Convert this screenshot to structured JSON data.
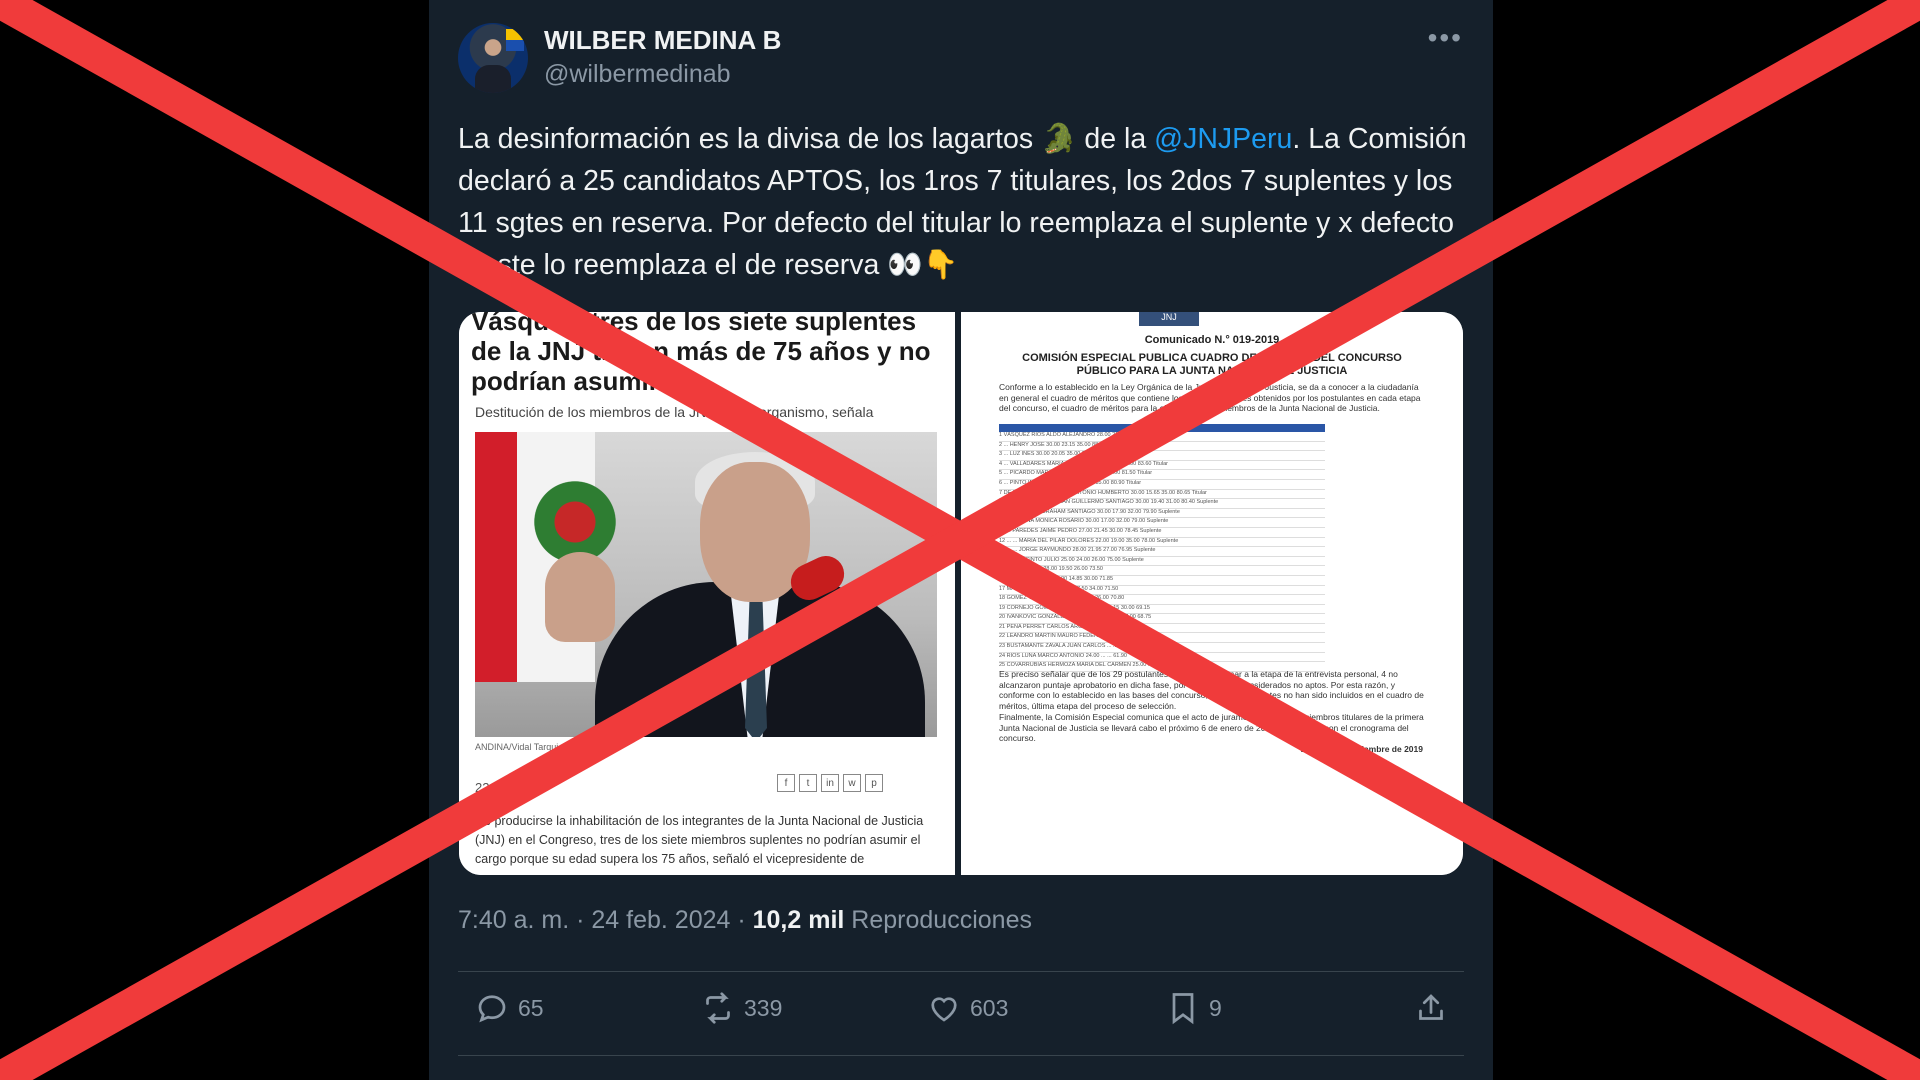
{
  "author": {
    "name": "WILBER MEDINA B",
    "handle": "@wilbermedinab"
  },
  "more_label": "•••",
  "tweet": {
    "t1": "La desinformación es la divisa de los lagartos",
    "emoji_lizard": "🐊",
    "t2": "de la",
    "mention": "@JNJPeru",
    "t3": ". La Comisión declaró a 25 candidatos APTOS, los 1ros 7 titulares, los 2dos 7 suplentes y los 11 sgtes en reserva. Por defecto del titular lo reemplaza el suplente y x defecto d este lo reemplaza el de reserva",
    "emoji_end": "👀👇"
  },
  "left_article": {
    "headline": "Vásquez, tres de los siete suplentes de la JNJ tienen más de 75 años y no podrían asumir",
    "subhead": "Destitución de los miembros de la JNJ... este organismo, señala",
    "credit": "ANDINA/Vidal Tarqui",
    "date": "22.",
    "share_icons": [
      "f",
      "t",
      "in",
      "w",
      "p"
    ],
    "paragraph": "De producirse la inhabilitación de los integrantes de la Junta Nacional de Justicia (JNJ) en el Congreso, tres de los siete miembros suplentes no podrían asumir el cargo porque su edad supera los 75 años, señaló el vicepresidente de"
  },
  "right_doc": {
    "logo": "JNJ",
    "comm": "Comunicado N.° 019-2019",
    "title": "COMISIÓN ESPECIAL PUBLICA CUADRO DE MÉRITOS DEL CONCURSO PÚBLICO PARA LA JUNTA NACIONAL DE JUSTICIA",
    "intro": "Conforme a lo establecido en la Ley Orgánica de la Junta Nacional de Justicia, se da a conocer a la ciudadanía en general el cuadro de méritos que contiene los resultados finales obtenidos por los postulantes en cada etapa del concurso, el cuadro de méritos para la elección de los miembros de la Junta Nacional de Justicia.",
    "rows": [
      "1  VÁSQUEZ  RÍOS  ALDO ALEJANDRO  28.00  21.75  35.00  90.75  Titular",
      "2  ...  HENRY JOSÉ  30.00  23.15  35.00  88.15  Titular",
      "3  ...  LUZ INÉS  30.00  20.05  35.00  84.05  Titular",
      "4  ...  VALLADARES  MARÍA AMABILIA  30.00  18.60  35.00  83.60  Titular",
      "5  ...  PICARDO  MARCO TULIO  20.00  23.50  32.00  81.50  Titular",
      "6  ...  PINTO  INGRID JULIA  25.00  20.90  35.00  80.90  Titular",
      "7  DE LA HAZA  BARRANTES  ANTONIO HUMBERTO  30.00  15.65  35.00  80.65  Titular",
      "8  THORNBERRY  VILLARÁN  GUILLERMO SANTIAGO  30.00  19.40  31.00  80.40  Suplente",
      "9  ...  VALLEJOS  ABRAHAM SANTIAGO  30.00  17.90  32.00  79.90  Suplente",
      "10  ...  MEDINA  MÓNICA ROSARIO  30.00  17.00  32.00  79.00  Suplente",
      "11  ...  PAREDES  JAIME PEDRO  27.00  21.45  30.00  78.45  Suplente",
      "12  ...  ...  MARÍA DEL PILAR DOLORES  22.00  19.00  35.00  78.00  Suplente",
      "13  ...  ...  JORGE RAYMUNDO  28.00  21.95  27.00  76.95  Suplente",
      "14  ...  ...  JACINTO JULIO  25.00  24.00  26.00  75.00  Suplente",
      "15  LA FUEN  ...  ...  28.00  19.50  26.00  73.50  ",
      "16  RODRÍGUEZ  ...  ...  25.00  14.85  30.00  71.85  ",
      "17  MALDOS  BLANCO  ...  30.00  7.50  34.00  71.50  ",
      "18  GÓMEZ  VALVERDE  ...  24.00  20.80  26.00  70.80  ",
      "19  CORNEJO  GÓMEZ SÁNCHEZ  ...  28.00  11.15  30.00  69.15  ",
      "20  IVANKOVIC  GONZALEZ  GERMÁN  30.00  1.75  37.00  68.75  ",
      "21  PEÑA  PERRET  CARLOS ARGUS  ...  21.00  30.00  68.00  ",
      "22  LEANDRO  MARTÍN  MAURO FEDERICO  ...  ...  27.00  64.50  ",
      "23  BUSTAMANTE  ZAVALA  JUAN CARLOS  ...  ...  30.00  62.40  ",
      "24  RÍOS  LUNA  MARCO ANTONIO  24.00  ...  ...  61.90  ",
      "25  COVARRUBIAS  HERMOZA  MARÍA DEL CARMEN  25.00  ...  ...  58.85  "
    ],
    "note": "Es preciso señalar que de los 29 postulantes que lograron pasar a la etapa de la entrevista personal, 4 no alcanzaron puntaje aprobatorio en dicha fase, por lo que fueron considerados no aptos. Por esta razón, y conforme con lo establecido en las bases del concurso, esos 4 postulantes no han sido incluidos en el cuadro de méritos, última etapa del proceso de selección.",
    "final": "Finalmente, la Comisión Especial comunica que el acto de juramentación de los miembros titulares de la primera Junta Nacional de Justicia se llevará cabo el próximo 6 de enero de 2020, de acuerdo con el cronograma del concurso.",
    "place": "Lima, 30 de diciembre de 2019"
  },
  "meta": {
    "time_date": "7:40 a. m. · 24 feb. 2024 · ",
    "views": "10,2 mil",
    "views_label": " Reproducciones"
  },
  "actions": {
    "replies": "65",
    "retweets": "339",
    "likes": "603",
    "bookmarks": "9"
  },
  "overlay": {
    "color": "#f03b3b"
  }
}
